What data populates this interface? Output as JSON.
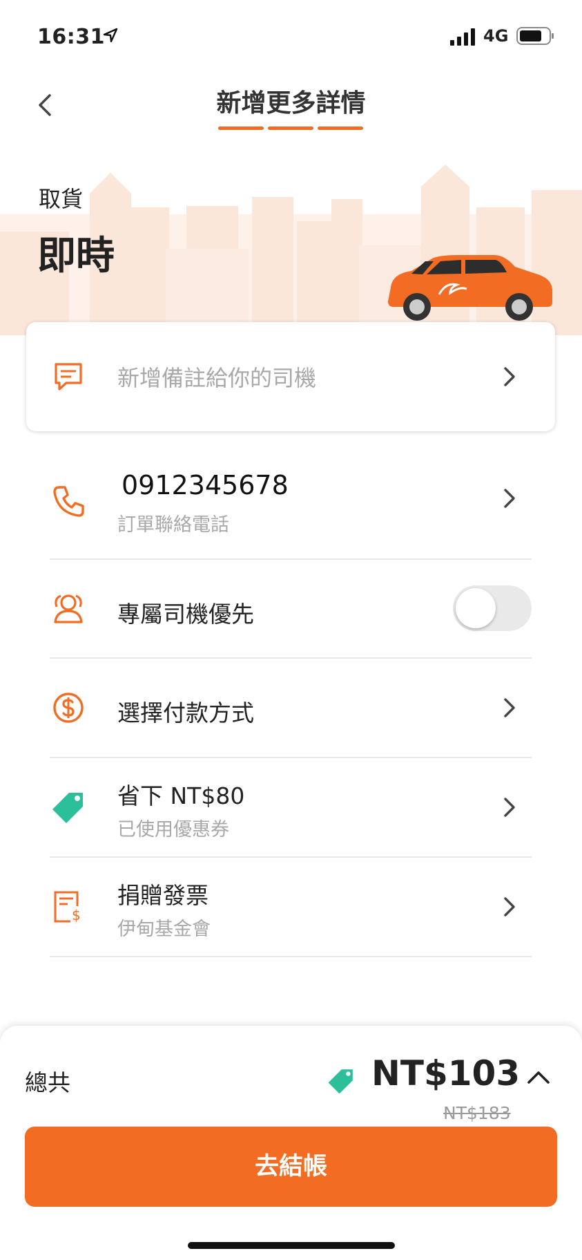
{
  "status_bar": {
    "time": "16:31",
    "network": "4G"
  },
  "header": {
    "title": "新增更多詳情"
  },
  "pickup": {
    "label": "取貨",
    "value": "即時"
  },
  "note": {
    "placeholder": "新增備註給你的司機"
  },
  "contact": {
    "phone": "0912345678",
    "caption": "訂單聯絡電話"
  },
  "driver_priority": {
    "label": "專屬司機優先",
    "enabled": false
  },
  "payment": {
    "label": "選擇付款方式"
  },
  "coupon": {
    "title": "省下 NT$80",
    "caption": "已使用優惠券"
  },
  "invoice": {
    "title": "捐贈發票",
    "caption": "伊甸基金會"
  },
  "footer": {
    "total_label": "總共",
    "total_price": "NT$103",
    "original_price": "NT$183",
    "checkout_label": "去結帳"
  },
  "colors": {
    "accent": "#f26c24",
    "coupon_green": "#2bbf9a",
    "muted_text": "#a8a8a8"
  }
}
